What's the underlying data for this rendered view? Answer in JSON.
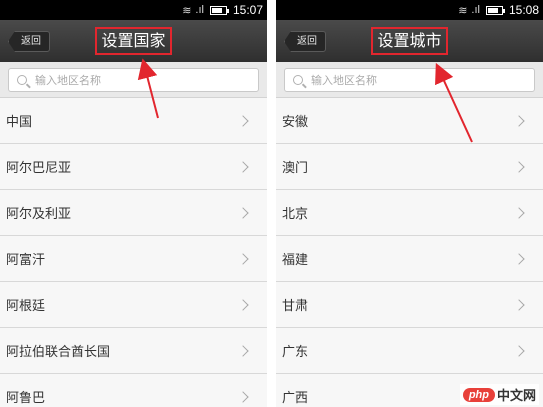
{
  "left": {
    "status": {
      "time": "15:07",
      "battery_level": 0.8
    },
    "back_label": "返回",
    "title": "设置国家",
    "search_placeholder": "输入地区名称",
    "items": [
      "中国",
      "阿尔巴尼亚",
      "阿尔及利亚",
      "阿富汗",
      "阿根廷",
      "阿拉伯联合酋长国",
      "阿鲁巴"
    ]
  },
  "right": {
    "status": {
      "time": "15:08",
      "battery_level": 0.8
    },
    "back_label": "返回",
    "title": "设置城市",
    "search_placeholder": "输入地区名称",
    "items": [
      "安徽",
      "澳门",
      "北京",
      "福建",
      "甘肃",
      "广东",
      "广西"
    ]
  },
  "watermark": {
    "logo": "php",
    "text": "中文网"
  },
  "colors": {
    "title_bar": "#3a3a3a",
    "highlight_box": "#e2262e",
    "arrow": "#e2262e"
  }
}
